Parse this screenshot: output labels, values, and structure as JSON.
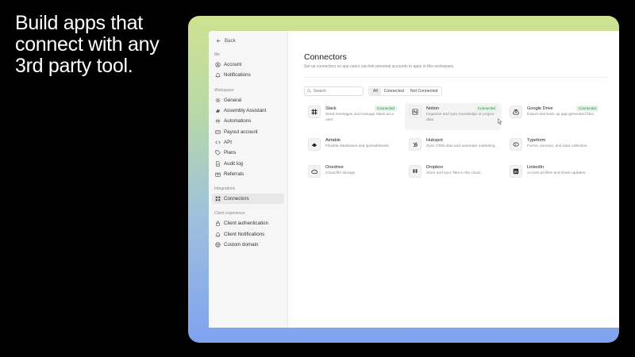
{
  "headline": [
    "Build apps that",
    "connect with any",
    "3rd party tool."
  ],
  "colors": {
    "accent_green": "#2f8a43",
    "badge_bg": "#e2f4e4",
    "gradient_top": "#cfe290",
    "gradient_bottom": "#7fa2f0"
  },
  "sidebar": {
    "back_label": "Back",
    "sections": [
      {
        "label": "Me",
        "items": [
          {
            "label": "Account",
            "icon": "user-circle-icon"
          },
          {
            "label": "Notifications",
            "icon": "bell-icon"
          }
        ]
      },
      {
        "label": "Workspace",
        "items": [
          {
            "label": "General",
            "icon": "gear-icon"
          },
          {
            "label": "Assembly Assistant",
            "icon": "sparkle-icon"
          },
          {
            "label": "Automations",
            "icon": "automation-icon"
          },
          {
            "label": "Payout account",
            "icon": "bank-icon"
          },
          {
            "label": "API",
            "icon": "code-icon"
          },
          {
            "label": "Plans",
            "icon": "tag-icon"
          },
          {
            "label": "Audit log",
            "icon": "file-icon"
          },
          {
            "label": "Referrals",
            "icon": "gift-icon"
          }
        ]
      },
      {
        "label": "Integrations",
        "items": [
          {
            "label": "Connectors",
            "icon": "grid-icon",
            "active": true
          }
        ]
      },
      {
        "label": "Client experience",
        "items": [
          {
            "label": "Client authentication",
            "icon": "lock-icon"
          },
          {
            "label": "Client Notifications",
            "icon": "bell-icon"
          },
          {
            "label": "Custom domain",
            "icon": "globe-icon"
          }
        ]
      }
    ]
  },
  "main": {
    "title": "Connectors",
    "subtitle": "Set up connectors so app users can link personal accounts to apps in this workspace.",
    "search_placeholder": "Search",
    "filters": [
      {
        "label": "All",
        "active": true
      },
      {
        "label": "Connected",
        "active": false
      },
      {
        "label": "Not Connected",
        "active": false
      }
    ],
    "connectors": [
      {
        "name": "Slack",
        "desc": "Send messages and manage Slack as a user",
        "connected": true,
        "badge": "Connected",
        "logo": "slack-icon"
      },
      {
        "name": "Notion",
        "desc": "Organize and sync knowledge or project data",
        "connected": true,
        "badge": "Connected",
        "logo": "notion-icon",
        "hover": true
      },
      {
        "name": "Google Drive",
        "desc": "Export and back up app-generated files.",
        "connected": true,
        "badge": "Connected",
        "logo": "google-drive-icon"
      },
      {
        "name": "Airtable",
        "desc": "Flexible databases and spreadsheets.",
        "connected": false,
        "badge": "",
        "logo": "airtable-icon"
      },
      {
        "name": "Hubspot",
        "desc": "Sync CRM data and automate marketing.",
        "connected": false,
        "badge": "",
        "logo": "hubspot-icon"
      },
      {
        "name": "Typeform",
        "desc": "Forms, surveys, and data collection.",
        "connected": false,
        "badge": "",
        "logo": "typeform-icon"
      },
      {
        "name": "Onedrive",
        "desc": "Cloud file storage.",
        "connected": false,
        "badge": "",
        "logo": "onedrive-icon"
      },
      {
        "name": "Dropbox",
        "desc": "Store and sync files in the cloud.",
        "connected": false,
        "badge": "",
        "logo": "dropbox-icon"
      },
      {
        "name": "LinkedIn",
        "desc": "Access profiles and share updates.",
        "connected": false,
        "badge": "",
        "logo": "linkedin-icon"
      }
    ]
  }
}
